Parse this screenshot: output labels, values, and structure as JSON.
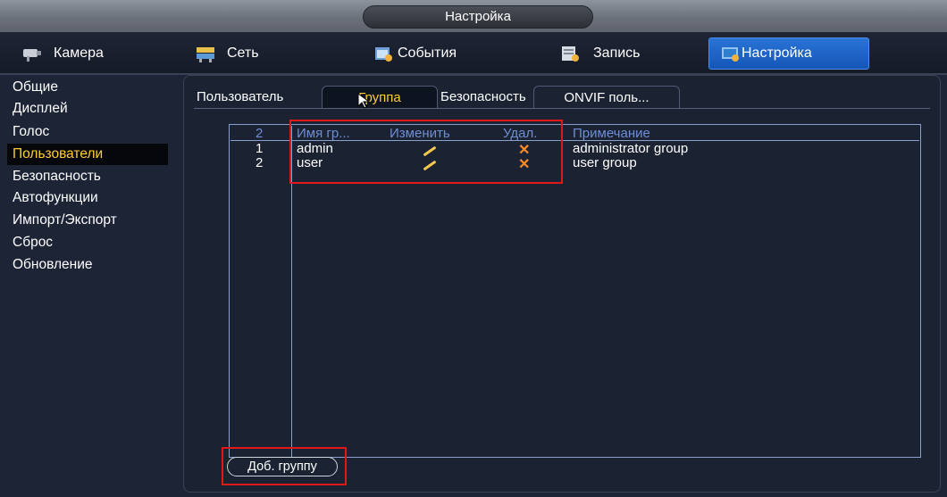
{
  "window": {
    "title": "Настройка"
  },
  "top_tabs": [
    {
      "label": "Камера",
      "icon": "camera-icon"
    },
    {
      "label": "Сеть",
      "icon": "network-icon"
    },
    {
      "label": "События",
      "icon": "events-icon"
    },
    {
      "label": "Запись",
      "icon": "record-icon"
    },
    {
      "label": "Настройка",
      "icon": "settings-icon",
      "active": true
    }
  ],
  "sidebar": {
    "items": [
      {
        "label": "Общие"
      },
      {
        "label": "Дисплей"
      },
      {
        "label": "Голос"
      },
      {
        "label": "Пользователи",
        "active": true
      },
      {
        "label": "Безопасность"
      },
      {
        "label": "Автофункции"
      },
      {
        "label": "Импорт/Экспорт"
      },
      {
        "label": "Сброс"
      },
      {
        "label": "Обновление"
      }
    ]
  },
  "sub_tabs": [
    {
      "label": "Пользователь"
    },
    {
      "label": "Группа",
      "active": true
    },
    {
      "label": "Безопасность"
    },
    {
      "label": "ONVIF поль..."
    }
  ],
  "table": {
    "count": "2",
    "headers": {
      "name": "Имя гр...",
      "edit": "Изменить",
      "delete": "Удал.",
      "note": "Примечание"
    },
    "rows": [
      {
        "index": "1",
        "name": "admin",
        "edit_icon": "pencil-icon",
        "delete_icon": "delete-x-icon",
        "note": "administrator group"
      },
      {
        "index": "2",
        "name": "user",
        "edit_icon": "pencil-icon",
        "delete_icon": "delete-x-icon",
        "note": "user group"
      }
    ]
  },
  "add_group_button": {
    "label": "Доб. группу"
  },
  "colors": {
    "accent_active": "#ffcc33",
    "tab_active": "#1f66c8",
    "header_text": "#6f8ed4",
    "highlight": "#e01818",
    "edit": "#f2c94c",
    "delete": "#ff8a2a"
  }
}
